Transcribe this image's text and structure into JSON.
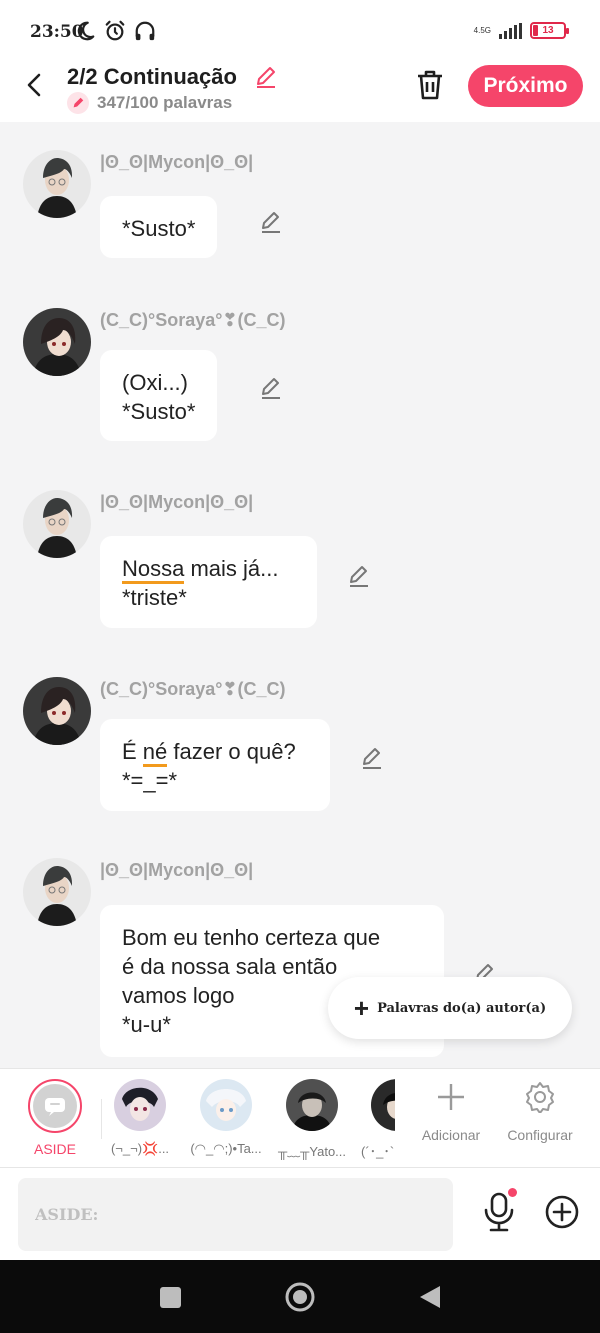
{
  "status": {
    "time": "23:50",
    "network": "4.5G",
    "battery": "13"
  },
  "header": {
    "title": "2/2 Continuação",
    "word_count": "347/100 palavras",
    "next_label": "Próximo"
  },
  "messages": [
    {
      "author": "|ʘ_ʘ|Mycon|ʘ_ʘ|",
      "text": "*Susto*"
    },
    {
      "author": "(C_C)°Soraya°❣(C_C)",
      "text": "(Oxi...)\n*Susto*"
    },
    {
      "author": "|ʘ_ʘ|Mycon|ʘ_ʘ|",
      "text_underlined": "Nossa",
      "text_rest": " mais já...\n*triste*"
    },
    {
      "author": "(C_C)°Soraya°❣(C_C)",
      "text_before": "É ",
      "text_underlined": "né",
      "text_rest": " fazer o quê?\n*=_=*"
    },
    {
      "author": "|ʘ_ʘ|Mycon|ʘ_ʘ|",
      "text": "Bom eu tenho certeza que\né da nossa sala então\nvamos logo\n*u-u*"
    }
  ],
  "floating": {
    "label": "Palavras do(a) autor(a)"
  },
  "characters": [
    {
      "label": "ASIDE"
    },
    {
      "label": "(¬_¬)💢..."
    },
    {
      "label": "(◠_◠;)•Ta..."
    },
    {
      "label": "╥﹏╥Yato..."
    },
    {
      "label": "(´･_･`..."
    }
  ],
  "tools": {
    "add_label": "Adicionar",
    "config_label": "Configurar"
  },
  "input": {
    "placeholder": "ASIDE:"
  },
  "colors": {
    "accent": "#f5456a",
    "underline": "#f29a1c"
  }
}
